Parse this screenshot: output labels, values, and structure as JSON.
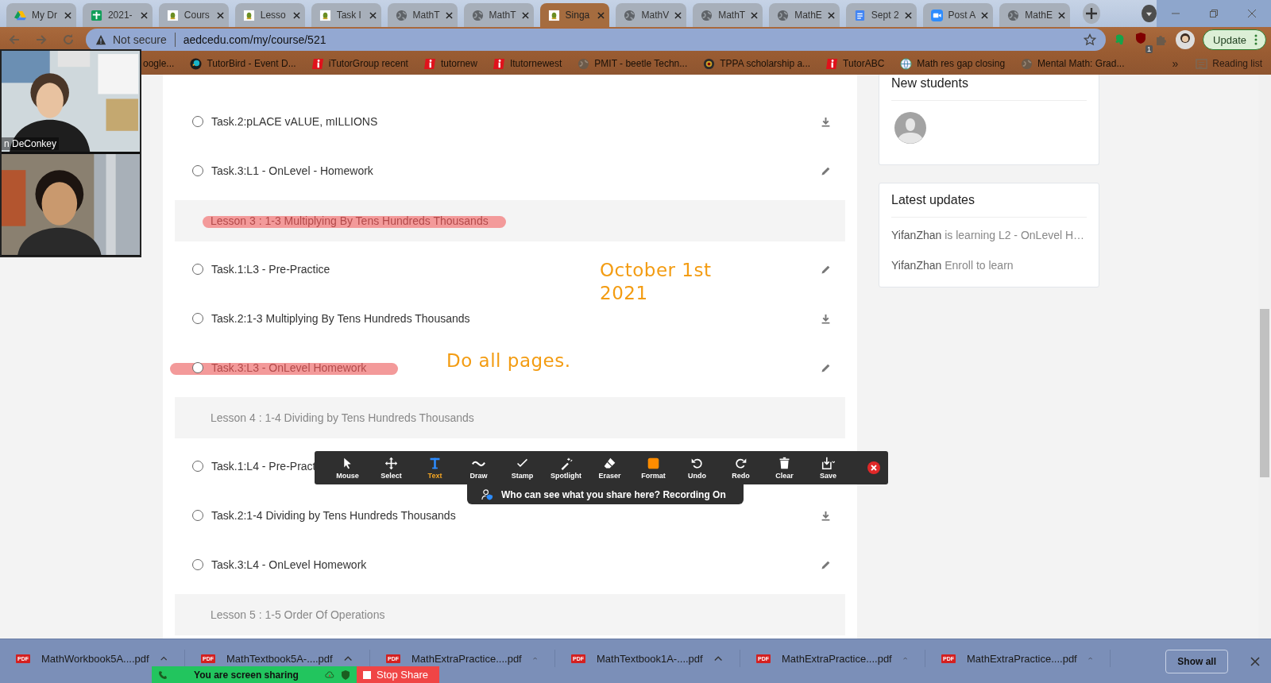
{
  "tabs": [
    {
      "label": "My Dr",
      "kind": "drive",
      "selected": false
    },
    {
      "label": "2021-",
      "kind": "sheets",
      "selected": false
    },
    {
      "label": "Cours",
      "kind": "school",
      "selected": false
    },
    {
      "label": "Lesso",
      "kind": "school",
      "selected": false
    },
    {
      "label": "Task l",
      "kind": "school",
      "selected": false
    },
    {
      "label": "MathT",
      "kind": "globe",
      "selected": false
    },
    {
      "label": "MathT",
      "kind": "globe",
      "selected": false
    },
    {
      "label": "Singa",
      "kind": "school",
      "selected": true
    },
    {
      "label": "MathV",
      "kind": "globe",
      "selected": false
    },
    {
      "label": "MathT",
      "kind": "globe",
      "selected": false
    },
    {
      "label": "MathE",
      "kind": "globe",
      "selected": false
    },
    {
      "label": "Sept 2",
      "kind": "docs",
      "selected": false
    },
    {
      "label": "Post A",
      "kind": "zoom",
      "selected": false
    },
    {
      "label": "MathE",
      "kind": "globe",
      "selected": false
    }
  ],
  "address_bar": {
    "security": "Not secure",
    "url": "aedcedu.com/my/course/521"
  },
  "toolbar": {
    "extension_badge": "1",
    "update_button": "Update"
  },
  "bookmarks": [
    {
      "label": "oogle...",
      "kind": "plain"
    },
    {
      "label": "TutorBird - Event D...",
      "kind": "bird"
    },
    {
      "label": "iTutorGroup recent",
      "kind": "itutor"
    },
    {
      "label": "tutornew",
      "kind": "itutor"
    },
    {
      "label": "Itutornewest",
      "kind": "itutor"
    },
    {
      "label": "PMIT - beetle Techn...",
      "kind": "globe"
    },
    {
      "label": "TPPA scholarship a...",
      "kind": "crest"
    },
    {
      "label": "TutorABC",
      "kind": "itutor"
    },
    {
      "label": "Math res gap closing",
      "kind": "web"
    },
    {
      "label": "Mental Math: Grad...",
      "kind": "globe"
    }
  ],
  "bookmarks_overflow": "»",
  "reading_list": "Reading list",
  "video_panel": {
    "tiles": [
      {
        "kind": "picture",
        "name": "n DeConkey"
      },
      {
        "kind": "picture"
      }
    ]
  },
  "course_items": [
    {
      "kind": "download",
      "label": "Task.2:pLACE vALUE, mILLIONS",
      "checked": false,
      "highlighted": false
    },
    {
      "kind": "edit",
      "label": "Task.3:L1 - OnLevel - Homework",
      "checked": false,
      "highlighted": false
    },
    {
      "kind": "lesson",
      "label": "Lesson 3 : 1-3 Multiplying By Tens Hundreds Thousands",
      "highlighted": true
    },
    {
      "kind": "edit",
      "label": "Task.1:L3 - Pre-Practice",
      "checked": false,
      "highlighted": false
    },
    {
      "kind": "download",
      "label": "Task.2:1-3 Multiplying By Tens Hundreds Thousands",
      "checked": false,
      "highlighted": false
    },
    {
      "kind": "edit",
      "label": "Task.3:L3 - OnLevel Homework",
      "checked": false,
      "highlighted": true
    },
    {
      "kind": "lesson",
      "label": "Lesson 4 : 1-4 Dividing by Tens Hundreds Thousands",
      "highlighted": false
    },
    {
      "kind": "plain",
      "label": "Task.1:L4 - Pre-Pract",
      "checked": false,
      "highlighted": false
    },
    {
      "kind": "download",
      "label": "Task.2:1-4 Dividing by Tens Hundreds Thousands",
      "checked": false,
      "highlighted": false
    },
    {
      "kind": "edit",
      "label": "Task.3:L4 - OnLevel Homework",
      "checked": false,
      "highlighted": false
    },
    {
      "kind": "lesson",
      "label": "Lesson 5 : 1-5 Order Of Operations",
      "highlighted": false
    }
  ],
  "annotations": [
    {
      "lines": [
        "October 1st",
        "2021"
      ]
    },
    {
      "lines": [
        "Do all pages."
      ]
    }
  ],
  "side_cards": [
    {
      "kind": "avatars",
      "title": "New students"
    },
    {
      "kind": "updates",
      "title": "Latest updates",
      "updates": [
        {
          "user": "YifanZhan",
          "text": "is learning L2 - OnLevel H…"
        },
        {
          "user": "YifanZhan",
          "text": "Enroll to learn"
        }
      ]
    }
  ],
  "annotate_toolbar": {
    "tools": [
      {
        "label": "Mouse",
        "kind": "mouse",
        "selected": false
      },
      {
        "label": "Select",
        "kind": "move",
        "selected": false
      },
      {
        "label": "Text",
        "kind": "text",
        "selected": true
      },
      {
        "label": "Draw",
        "kind": "wave",
        "selected": false
      },
      {
        "label": "Stamp",
        "kind": "check",
        "selected": false
      },
      {
        "label": "Spotlight",
        "kind": "wand",
        "selected": false
      },
      {
        "label": "Eraser",
        "kind": "eraser",
        "selected": false
      },
      {
        "label": "Format",
        "kind": "swatch",
        "selected": false
      },
      {
        "label": "Undo",
        "kind": "undo",
        "selected": false
      },
      {
        "label": "Redo",
        "kind": "redo",
        "selected": false
      },
      {
        "label": "Clear",
        "kind": "trash",
        "selected": false
      },
      {
        "label": "Save",
        "kind": "save",
        "selected": false
      }
    ],
    "notice": "Who can see what you share here? Recording On"
  },
  "downloads": [
    {
      "file": "MathWorkbook5A....pdf",
      "icon_label": "PDF"
    },
    {
      "file": "MathTextbook5A-....pdf",
      "icon_label": "PDF"
    },
    {
      "file": "MathExtraPractice....pdf",
      "icon_label": "PDF"
    },
    {
      "file": "MathTextbook1A-....pdf",
      "icon_label": "PDF"
    },
    {
      "file": "MathExtraPractice....pdf",
      "icon_label": "PDF"
    },
    {
      "file": "MathExtraPractice....pdf",
      "icon_label": "PDF"
    }
  ],
  "show_all": "Show all",
  "share_bar": {
    "status": "You are screen sharing",
    "stop": "Stop Share"
  }
}
